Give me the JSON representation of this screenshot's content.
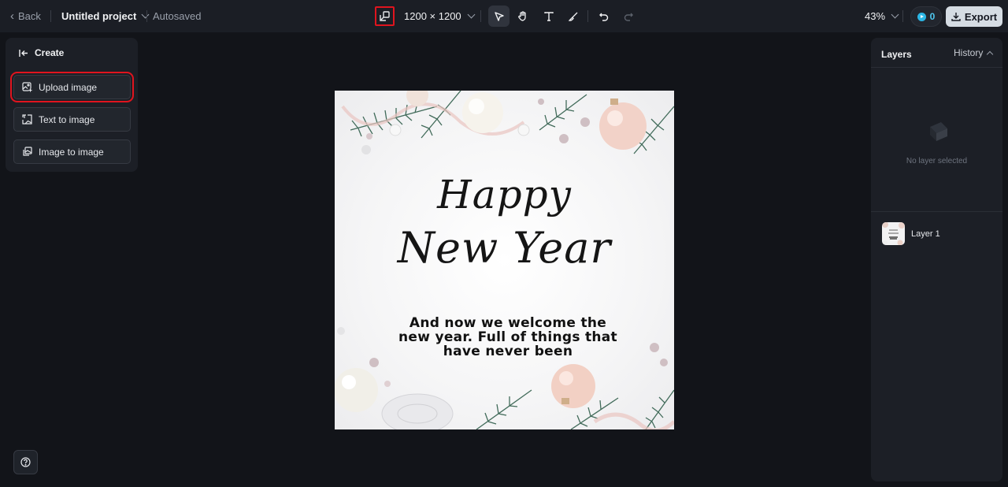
{
  "topbar": {
    "back_label": "Back",
    "project_title": "Untitled project",
    "autosave_status": "Autosaved",
    "canvas_size": "1200 × 1200",
    "zoom": "43%",
    "credits": "0",
    "export_label": "Export"
  },
  "tools": [
    "select",
    "hand",
    "text",
    "brush",
    "undo",
    "redo"
  ],
  "left_panel": {
    "title": "Create",
    "buttons": [
      "Upload image",
      "Text to image",
      "Image to image"
    ]
  },
  "canvas": {
    "headline_line1": "Happy",
    "headline_line2": "New Year",
    "body": "And now we welcome the new year. Full of things that have never been"
  },
  "right_panel": {
    "layers_title": "Layers",
    "history_label": "History",
    "empty_text": "No layer selected",
    "layers": [
      "Layer 1"
    ]
  },
  "colors": {
    "highlight": "#e0141e",
    "credits_accent": "#2cb7e6",
    "export_bg": "#d5dce3"
  }
}
